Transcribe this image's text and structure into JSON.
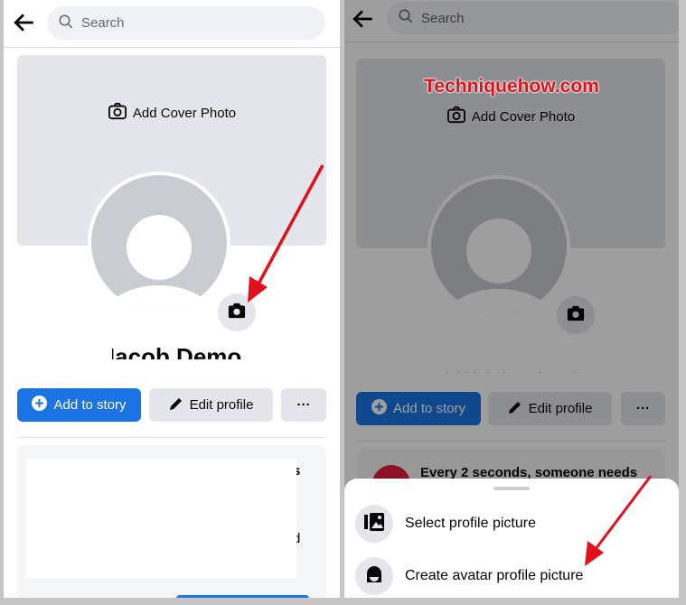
{
  "left": {
    "search_placeholder": "Search",
    "cover_label": "Add Cover Photo",
    "name": "Jacob Demo",
    "add_story": "Add to story",
    "edit_profile": "Edit profile",
    "more": "···",
    "card_fragments": [
      "s",
      "d"
    ]
  },
  "right": {
    "search_placeholder": "Search",
    "watermark": "Techniquehow.com",
    "cover_label": "Add Cover Photo",
    "name": "Jacob Demo",
    "add_story": "Add to story",
    "edit_profile": "Edit profile",
    "more": "···",
    "card_text": "Every 2 seconds, someone needs",
    "sheet": {
      "options": [
        {
          "label": "Select profile picture",
          "icon": "photo-gallery-icon"
        },
        {
          "label": "Create avatar profile picture",
          "icon": "avatar-icon"
        }
      ]
    }
  },
  "colors": {
    "accent": "#1b74e4",
    "arrow": "#e0111b",
    "watermark": "#e0111b"
  }
}
